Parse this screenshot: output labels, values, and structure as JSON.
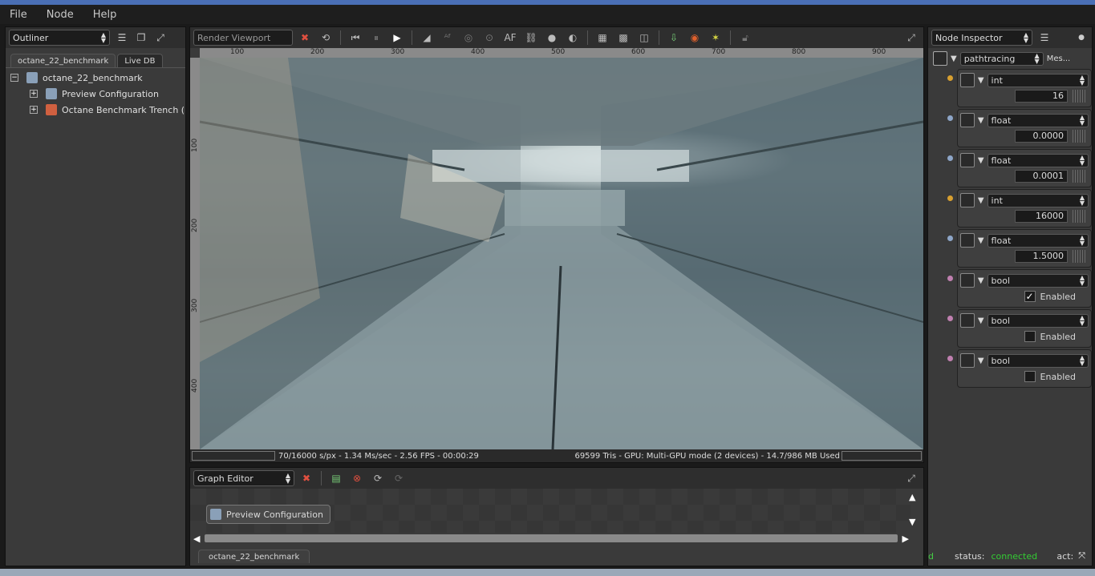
{
  "menu": [
    "File",
    "Node",
    "Help"
  ],
  "outliner": {
    "title": "Outliner",
    "tabs": [
      "octane_22_benchmark",
      "Live DB"
    ],
    "tree": {
      "root": "octane_22_benchmark",
      "children": [
        "Preview Configuration",
        "Octane Benchmark Trench (CLIC"
      ]
    }
  },
  "viewport": {
    "title": "Render Viewport",
    "toolbar_text": "AF",
    "ruler_h": [
      "100",
      "200",
      "300",
      "400",
      "500",
      "600",
      "700",
      "800",
      "900"
    ],
    "ruler_v": [
      "100",
      "200",
      "300",
      "400"
    ],
    "status_left": "70/16000 s/px - 1.34 Ms/sec - 2.56 FPS - 00:00:29",
    "status_right": "69599 Tris - GPU: Multi-GPU mode (2 devices) - 14.7/986 MB Used"
  },
  "graph_editor": {
    "title": "Graph Editor",
    "node_label": "Preview Configuration",
    "tab": "octane_22_benchmark"
  },
  "inspector": {
    "title": "Node Inspector",
    "kernel": "pathtracing",
    "kernel_extra": "Mes...",
    "slots": [
      {
        "type": "int",
        "value": "16",
        "color": "#d8a030"
      },
      {
        "type": "float",
        "value": "0.0000",
        "color": "#8ea6c8"
      },
      {
        "type": "float",
        "value": "0.0001",
        "color": "#8ea6c8"
      },
      {
        "type": "int",
        "value": "16000",
        "color": "#d8a030"
      },
      {
        "type": "float",
        "value": "1.5000",
        "color": "#8ea6c8"
      },
      {
        "type": "bool",
        "value": "Enabled",
        "checked": true,
        "color": "#c080b0"
      },
      {
        "type": "bool",
        "value": "Enabled",
        "checked": false,
        "color": "#c080b0"
      },
      {
        "type": "bool",
        "value": "Enabled",
        "checked": false,
        "color": "#c080b0"
      }
    ],
    "status_label": "status:",
    "status_value": "connected",
    "act_label": "act:",
    "left_fragment": "d"
  }
}
